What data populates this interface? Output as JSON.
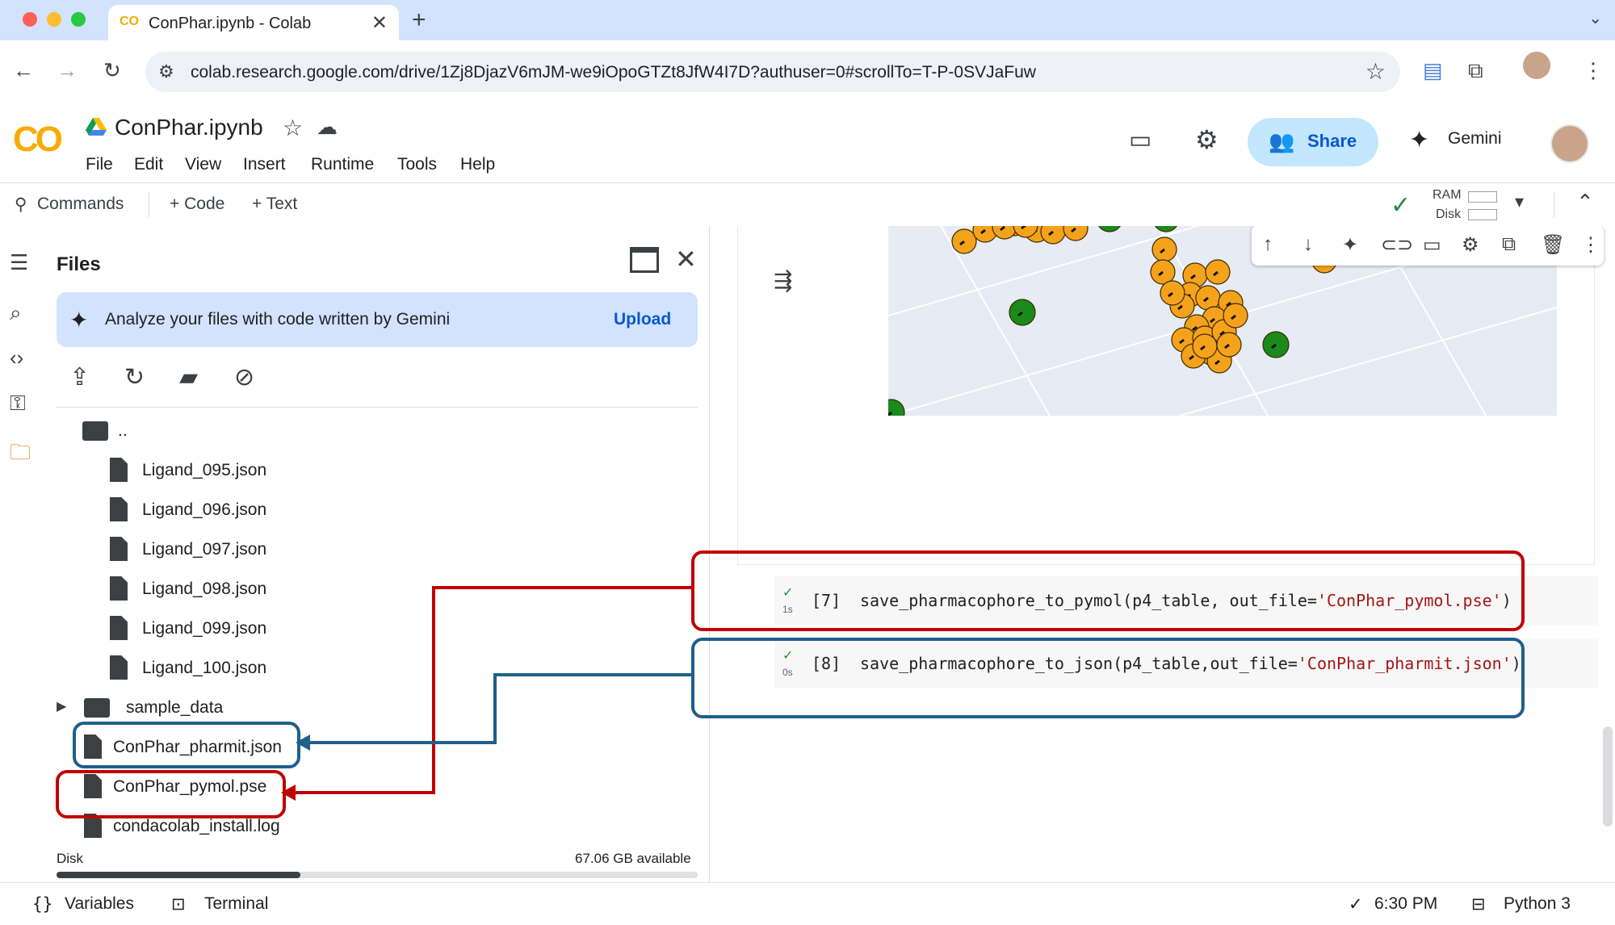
{
  "browser": {
    "tab_title": "ConPhar.ipynb - Colab",
    "url": "colab.research.google.com/drive/1Zj8DjazV6mJM-we9iOpoGTZt8JfW4I7D?authuser=0#scrollTo=T-P-0SVJaFuw"
  },
  "header": {
    "logo": "CO",
    "notebook_title": "ConPhar.ipynb",
    "menu": [
      "File",
      "Edit",
      "View",
      "Insert",
      "Runtime",
      "Tools",
      "Help"
    ],
    "share_label": "Share",
    "gemini_label": "Gemini"
  },
  "toolbar": {
    "commands_label": "Commands",
    "add_code_label": "+ Code",
    "add_text_label": "+ Text",
    "ram_label": "RAM",
    "disk_label": "Disk"
  },
  "files_panel": {
    "title": "Files",
    "banner_text": "Analyze your files with code written by Gemini",
    "upload_label": "Upload",
    "parent_folder_label": "..",
    "ligand_files": [
      "Ligand_095.json",
      "Ligand_096.json",
      "Ligand_097.json",
      "Ligand_098.json",
      "Ligand_099.json",
      "Ligand_100.json"
    ],
    "sample_folder": "sample_data",
    "output_files": [
      "ConPhar_pharmit.json",
      "ConPhar_pymol.pse",
      "condacolab_install.log"
    ],
    "disk_label": "Disk",
    "disk_available": "67.06 GB available",
    "disk_used_fraction": 0.38
  },
  "cells": [
    {
      "status": "1s",
      "number": "[7]",
      "code_prefix": "save_pharmacophore_to_pymol(p4_table, out_file=",
      "code_string": "'ConPhar_pymol.pse'",
      "code_suffix": ")"
    },
    {
      "status": "0s",
      "number": "[8]",
      "code_prefix": "save_pharmacophore_to_json(p4_table,out_file=",
      "code_string": "'ConPhar_pharmit.json'",
      "code_suffix": ")"
    }
  ],
  "statusbar": {
    "variables_label": "Variables",
    "terminal_label": "Terminal",
    "time": "6:30 PM",
    "runtime": "Python 3"
  },
  "colors": {
    "annotation_red": "#c00000",
    "annotation_blue": "#1f5f8b",
    "plot_orange": "#f5a21b",
    "plot_green": "#1a8a1a"
  },
  "icons": [
    "colab-logo",
    "drive-icon",
    "star-icon",
    "cloud-icon",
    "comment-icon",
    "gear-icon",
    "share-people-icon",
    "gemini-spark-icon",
    "search-icon",
    "checkmark-icon",
    "chevron-down-icon",
    "chevron-up-icon",
    "toc-icon",
    "find-icon",
    "code-icon",
    "key-icon",
    "folder-icon",
    "upload-file-icon",
    "refresh-icon",
    "drive-folder-icon",
    "hide-icon",
    "file-icon",
    "arrow-up-icon",
    "arrow-down-icon",
    "link-icon",
    "mirror-icon",
    "trash-icon",
    "more-icon",
    "terminal-icon",
    "variables-icon"
  ]
}
